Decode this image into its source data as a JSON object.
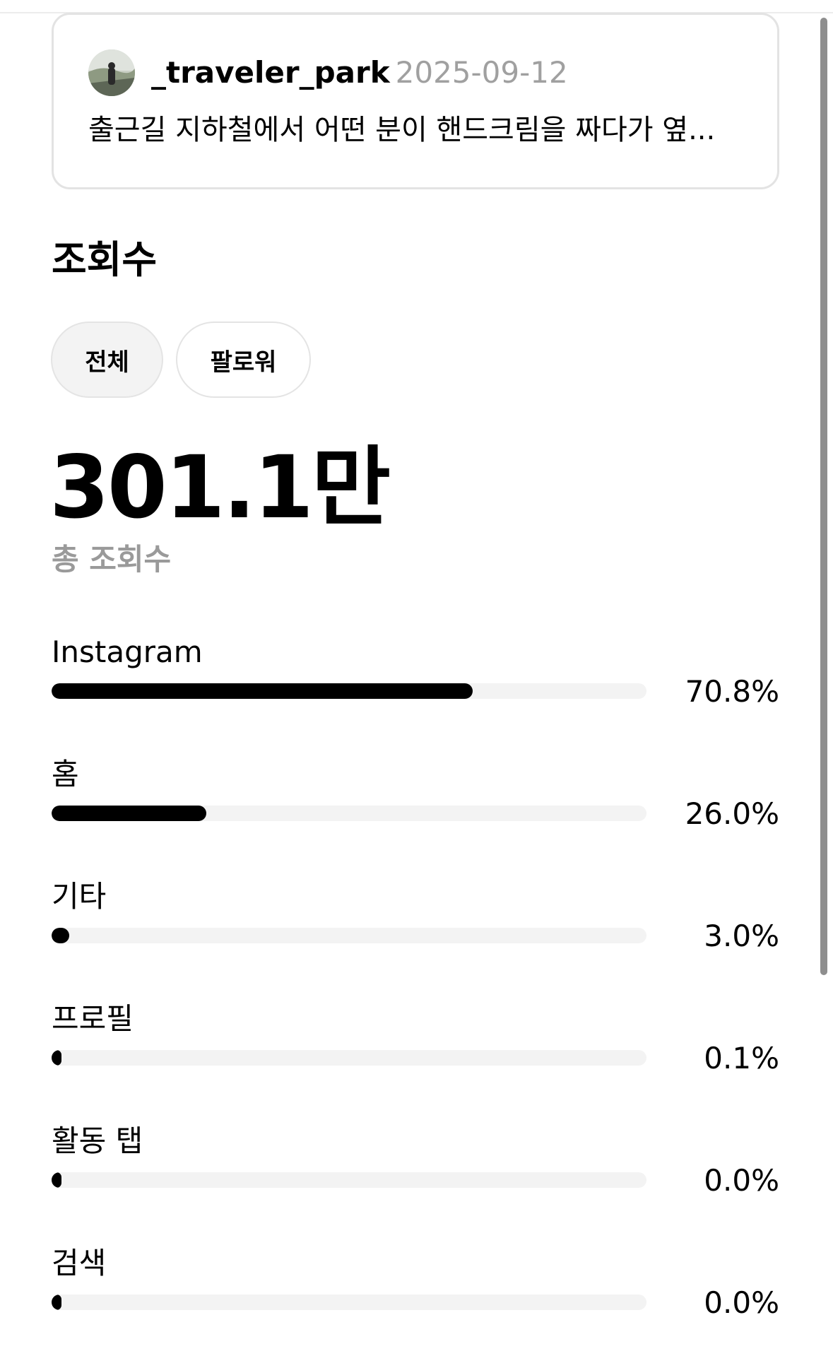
{
  "post": {
    "username": "_traveler_park",
    "date": "2025-09-12",
    "caption": "출근길 지하철에서 어떤 분이 핸드크림을 짜다가 옆..."
  },
  "views": {
    "title": "조회수",
    "filters": [
      {
        "label": "전체",
        "selected": true
      },
      {
        "label": "팔로워",
        "selected": false
      }
    ],
    "total_value": "301.1만",
    "total_label": "총 조회수"
  },
  "sources": [
    {
      "label": "Instagram",
      "percent_text": "70.8%",
      "percent": 70.8
    },
    {
      "label": "홈",
      "percent_text": "26.0%",
      "percent": 26.0
    },
    {
      "label": "기타",
      "percent_text": "3.0%",
      "percent": 3.0
    },
    {
      "label": "프로필",
      "percent_text": "0.1%",
      "percent": 0.1
    },
    {
      "label": "활동 탭",
      "percent_text": "0.0%",
      "percent": 0.0
    },
    {
      "label": "검색",
      "percent_text": "0.0%",
      "percent": 0.0
    }
  ],
  "colors": {
    "bar_fill": "#000000",
    "bar_track": "#f3f3f3",
    "muted_text": "#9a9a9a",
    "card_border": "#e3e3e3"
  }
}
